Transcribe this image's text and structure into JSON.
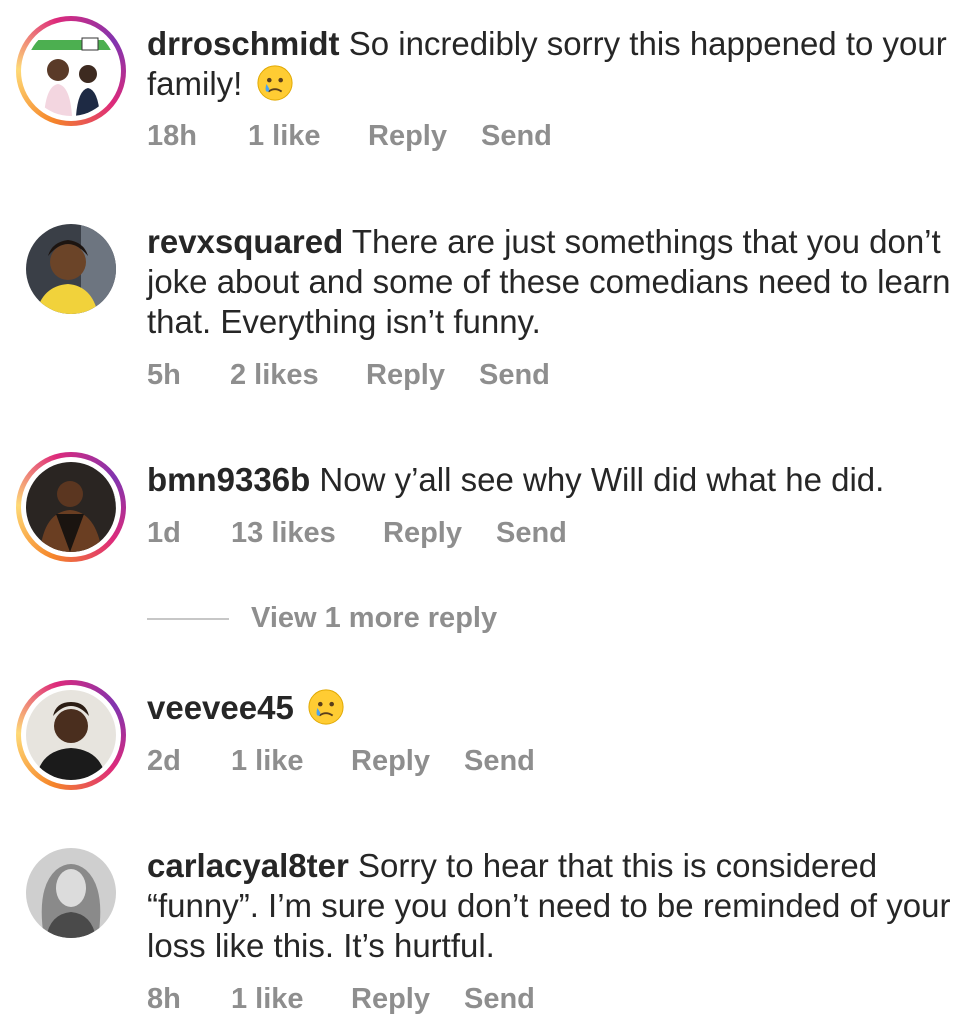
{
  "comments": [
    {
      "username": "drroschmidt",
      "text": "So incredibly sorry this happened to your family!",
      "emoji": "crying-face",
      "time": "18h",
      "likes": "1 like",
      "reply": "Reply",
      "send": "Send",
      "avatar_icon": "avatar-drroschmidt-icon"
    },
    {
      "username": "revxsquared",
      "text": "There are just somethings that you don’t joke about and some of these comedians need to learn that. Everything isn’t funny.",
      "time": "5h",
      "likes": "2 likes",
      "reply": "Reply",
      "send": "Send",
      "avatar_icon": "avatar-revxsquared-icon"
    },
    {
      "username": "bmn9336b",
      "text": "Now y’all see why Will did what he did.",
      "time": "1d",
      "likes": "13 likes",
      "reply": "Reply",
      "send": "Send",
      "avatar_icon": "avatar-bmn9336b-icon"
    },
    {
      "username": "veevee45",
      "text": "",
      "emoji": "crying-face",
      "time": "2d",
      "likes": "1 like",
      "reply": "Reply",
      "send": "Send",
      "avatar_icon": "avatar-veevee45-icon"
    },
    {
      "username": "carlacyal8ter",
      "text": "Sorry to hear that this is considered “funny”. I’m sure you don’t need to be reminded of your loss like this. It’s hurtful.",
      "time": "8h",
      "likes": "1 like",
      "reply": "Reply",
      "send": "Send",
      "avatar_icon": "avatar-carlacyal8ter-icon"
    }
  ],
  "view_more_replies": "View 1 more reply",
  "colors": {
    "text": "#262626",
    "meta": "#8e8e8e",
    "story_ring_start": "#f58529",
    "story_ring_end": "#dd2a7b"
  }
}
